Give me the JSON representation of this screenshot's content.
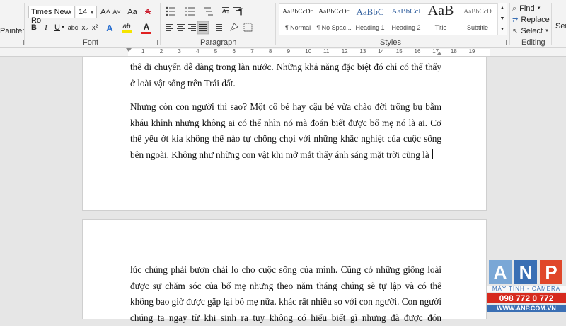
{
  "ribbon": {
    "clipboard": {
      "painter_label": "Painter"
    },
    "font": {
      "group_label": "Font",
      "font_name": "Times New Ro",
      "font_size": "14",
      "grow_icon": "A˄",
      "shrink_icon": "A˅",
      "case_icon": "Aa",
      "clear_icon": "A",
      "bold": "B",
      "italic": "I",
      "underline": "U",
      "strike": "abc",
      "subscript": "x₂",
      "superscript": "x²",
      "text_effects": "A",
      "highlight": "ab",
      "font_color": "A",
      "highlight_color": "#f5e400",
      "font_color_bar": "#e02020"
    },
    "paragraph": {
      "group_label": "Paragraph"
    },
    "styles": {
      "group_label": "Styles",
      "items": [
        {
          "sample": "AaBbCcDc",
          "name": "¶ Normal"
        },
        {
          "sample": "AaBbCcDc",
          "name": "¶ No Spac..."
        },
        {
          "sample": "AaBbC",
          "name": "Heading 1"
        },
        {
          "sample": "AaBbCcl",
          "name": "Heading 2"
        },
        {
          "sample": "AaB",
          "name": "Title"
        },
        {
          "sample": "AaBbCcD",
          "name": "Subtitle"
        }
      ]
    },
    "editing": {
      "group_label": "Editing",
      "find": "Find",
      "replace": "Replace",
      "select": "Select"
    },
    "overflow_label": "Sen"
  },
  "ruler": {
    "numbers": [
      "1",
      "2",
      "3",
      "4",
      "5",
      "6",
      "7",
      "8",
      "9",
      "10",
      "11",
      "12",
      "13",
      "14",
      "15",
      "16",
      "17",
      "18",
      "19"
    ]
  },
  "page1": {
    "para1": [
      "thể di chuyển dễ dàng trong làn nước. Những khả năng đặc biệt đó chỉ có thể thấy",
      "ở loài vật sống trên Trái đất."
    ],
    "para2": [
      "Nhưng còn con người thì sao? Một cô bé hay cậu bé vừa chào đời trông bụ bẫm",
      "kháu khỉnh nhưng không ai có thể nhìn nó mà đoán biết được bố mẹ nó là ai. Cơ",
      "thể yếu ớt kia không thể nào tự chống chọi với những khắc nghiệt của cuộc sống",
      "bên ngoài. Không như những con vật khi mở mắt thấy ánh sáng mặt trời cũng là"
    ]
  },
  "page2": {
    "para": [
      "lúc chúng phải bươn chải lo cho cuộc sống của mình. Cũng có những giống loài",
      "được sự chăm sóc của bố mẹ nhưng theo năm tháng chúng sẽ tự lập và có thể",
      "không bao giờ được gặp lại bố mẹ nữa. khác rất nhiều so với con người. Con người",
      "chúng ta ngay từ khi sinh ra tuy không có hiểu biết gì nhưng đã được đón"
    ]
  },
  "logo": {
    "letters": [
      "A",
      "N",
      "P"
    ],
    "tagline": "MÁY TÍNH - CAMERA",
    "phone": "098 772 0 772",
    "website": "WWW.ANP.COM.VN",
    "colors": {
      "a": "#7aa7d6",
      "n": "#3a6fb4",
      "p": "#e0472a",
      "phone": "#d62a1e",
      "web": "#3a6fb4"
    }
  }
}
